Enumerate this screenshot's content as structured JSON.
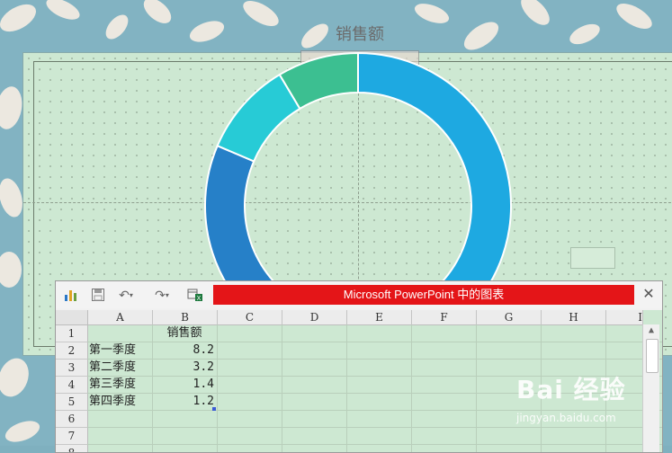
{
  "chart": {
    "title": "销售额"
  },
  "chart_data": {
    "type": "donut",
    "title": "销售额",
    "categories": [
      "第一季度",
      "第二季度",
      "第三季度",
      "第四季度"
    ],
    "values": [
      8.2,
      3.2,
      1.4,
      1.2
    ],
    "colors": [
      "#1ea9e1",
      "#2680c8",
      "#27cbd6",
      "#3cbf91"
    ]
  },
  "sheet": {
    "window_title": "Microsoft PowerPoint 中的图表",
    "close_label": "✕",
    "columns": [
      "A",
      "B",
      "C",
      "D",
      "E",
      "F",
      "G",
      "H",
      "I"
    ],
    "rows": [
      "1",
      "2",
      "3",
      "4",
      "5",
      "6",
      "7",
      "8"
    ],
    "header_b1": "销售额",
    "data": [
      {
        "label": "第一季度",
        "value": "8.2"
      },
      {
        "label": "第二季度",
        "value": "3.2"
      },
      {
        "label": "第三季度",
        "value": "1.4"
      },
      {
        "label": "第四季度",
        "value": "1.2"
      }
    ]
  },
  "watermark": {
    "logo": "Bai 经验",
    "url": "jingyan.baidu.com"
  }
}
